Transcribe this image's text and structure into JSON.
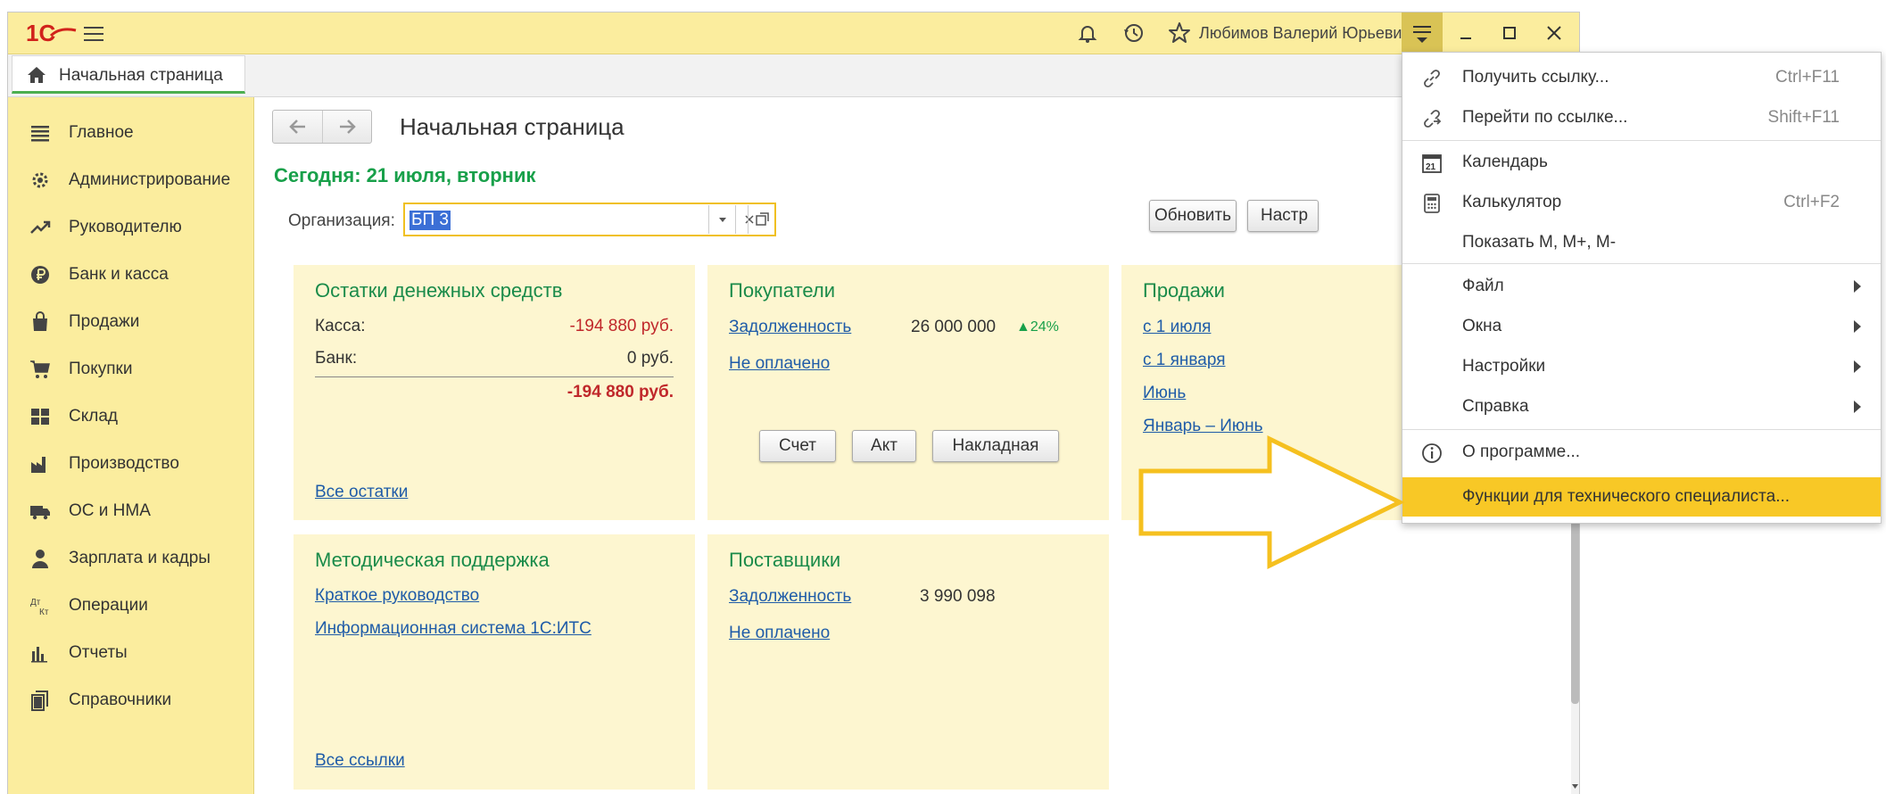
{
  "topbar": {
    "logo_text": "1С",
    "user": "Любимов Валерий Юрьевич",
    "icons": [
      "bell-icon",
      "history-icon",
      "star-icon",
      "menu-icon",
      "minimize-icon",
      "maximize-icon",
      "close-icon"
    ]
  },
  "tabs": [
    {
      "label": "Начальная страница"
    }
  ],
  "sidebar": {
    "items": [
      {
        "label": "Главное",
        "icon": "list-icon"
      },
      {
        "label": "Администрирование",
        "icon": "gear-icon"
      },
      {
        "label": "Руководителю",
        "icon": "trend-icon"
      },
      {
        "label": "Банк и касса",
        "icon": "ruble-icon"
      },
      {
        "label": "Продажи",
        "icon": "bag-icon"
      },
      {
        "label": "Покупки",
        "icon": "cart-icon"
      },
      {
        "label": "Склад",
        "icon": "warehouse-icon"
      },
      {
        "label": "Производство",
        "icon": "factory-icon"
      },
      {
        "label": "ОС и НМА",
        "icon": "truck-icon"
      },
      {
        "label": "Зарплата и кадры",
        "icon": "person-icon"
      },
      {
        "label": "Операции",
        "icon": "dt-kt-icon"
      },
      {
        "label": "Отчеты",
        "icon": "bar-chart-icon"
      },
      {
        "label": "Справочники",
        "icon": "books-icon"
      }
    ],
    "dtkt": {
      "dt": "Дт",
      "kt": "Кт"
    }
  },
  "main": {
    "title": "Начальная страница",
    "today": "Сегодня: 21 июля, вторник",
    "org_label": "Организация:",
    "org_value": "БП 3",
    "refresh": "Обновить",
    "settings": "Настр"
  },
  "panels": {
    "cash": {
      "title": "Остатки денежных средств",
      "kassa_label": "Касса:",
      "kassa_value": "-194 880 руб.",
      "bank_label": "Банк:",
      "bank_value": "0 руб.",
      "total": "-194 880 руб.",
      "link": "Все остатки"
    },
    "buyers": {
      "title": "Покупатели",
      "debt_link": "Задолженность",
      "debt_value": "26 000 000",
      "debt_change": "▲24%",
      "unpaid_link": "Не оплачено",
      "btn_invoice": "Счет",
      "btn_act": "Акт",
      "btn_waybill": "Накладная"
    },
    "sales": {
      "title": "Продажи",
      "links": [
        "с 1 июля",
        "с 1 января",
        "Июнь",
        "Январь – Июнь"
      ]
    },
    "support": {
      "title": "Методическая поддержка",
      "links": [
        "Краткое руководство",
        "Информационная система 1С:ИТС"
      ],
      "all_link": "Все ссылки"
    },
    "suppliers": {
      "title": "Поставщики",
      "debt_link": "Задолженность",
      "debt_value": "3 990 098",
      "unpaid_link": "Не оплачено"
    }
  },
  "menu": {
    "items": [
      {
        "label": "Получить ссылку...",
        "shortcut": "Ctrl+F11",
        "icon": "link-icon"
      },
      {
        "label": "Перейти по ссылке...",
        "shortcut": "Shift+F11",
        "icon": "go-link-icon"
      },
      {
        "label": "Календарь",
        "shortcut": "",
        "icon": "calendar-icon",
        "icon_text": "21"
      },
      {
        "label": "Калькулятор",
        "shortcut": "Ctrl+F2",
        "icon": "calculator-icon"
      },
      {
        "label": "Показать М, М+, М-",
        "shortcut": ""
      },
      {
        "label": "Файл",
        "submenu": true
      },
      {
        "label": "Окна",
        "submenu": true
      },
      {
        "label": "Настройки",
        "submenu": true
      },
      {
        "label": "Справка",
        "submenu": true
      },
      {
        "label": "О программе...",
        "icon": "info-icon"
      },
      {
        "label": "Функции для технического специалиста...",
        "highlighted": true
      }
    ]
  },
  "colors": {
    "accent_yellow": "#fbed9e",
    "highlight": "#f8c826",
    "green_title": "#1a8b4a",
    "link_blue": "#1f5ca8",
    "negative_red": "#c0282b",
    "panel_bg": "#fdf6d0"
  }
}
